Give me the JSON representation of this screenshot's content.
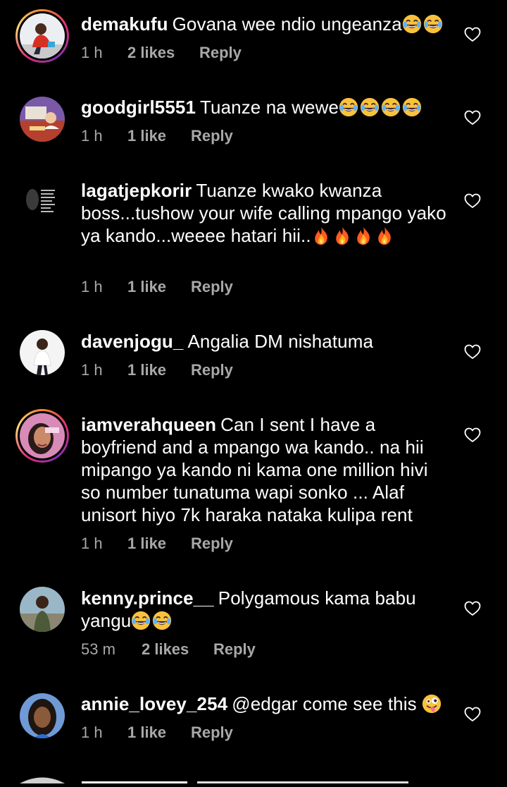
{
  "colors": {
    "background": "#000000",
    "text": "#ffffff",
    "muted": "#a8a8a8",
    "story_ring_start": "#f58529",
    "story_ring_end": "#dd2a7b"
  },
  "icons": {
    "like": "heart-outline-icon",
    "laugh": "face-with-tears-of-joy-emoji",
    "fire": "fire-emoji",
    "tongue": "winking-face-with-tongue-emoji"
  },
  "comments": [
    {
      "username": "demakufu",
      "text": "Govana wee ndio ungeanza",
      "emoji_count": 2,
      "time": "1 h",
      "likes": "2 likes",
      "reply": "Reply"
    },
    {
      "username": "goodgirl5551",
      "text": "Tuanze na wewe",
      "emoji_count": 4,
      "time": "1 h",
      "likes": "1 like",
      "reply": "Reply"
    },
    {
      "username": "lagatjepkorir",
      "text": "Tuanze kwako kwanza boss...tushow your wife calling  mpango yako ya kando...weeee hatari hii..",
      "emoji_count": 4,
      "time": "1 h",
      "likes": "1 like",
      "reply": "Reply"
    },
    {
      "username": "davenjogu_",
      "text": "Angalia DM nishatuma",
      "emoji_count": 0,
      "time": "1 h",
      "likes": "1 like",
      "reply": "Reply"
    },
    {
      "username": "iamverahqueen",
      "text": "Can I sent I have a boyfriend and a mpango wa kando.. na hii mipango ya kando ni kama one million hivi so number tunatuma wapi sonko ... Alaf unisort hiyo 7k haraka nataka kulipa rent",
      "emoji_count": 0,
      "time": "1 h",
      "likes": "1 like",
      "reply": "Reply"
    },
    {
      "username": "kenny.prince__",
      "text": "Polygamous kama babu yangu",
      "emoji_count": 2,
      "time": "53 m",
      "likes": "2 likes",
      "reply": "Reply"
    },
    {
      "username": "annie_lovey_254",
      "text": "@edgar come see this",
      "emoji_count": 1,
      "time": "1 h",
      "likes": "1 like",
      "reply": "Reply"
    }
  ]
}
